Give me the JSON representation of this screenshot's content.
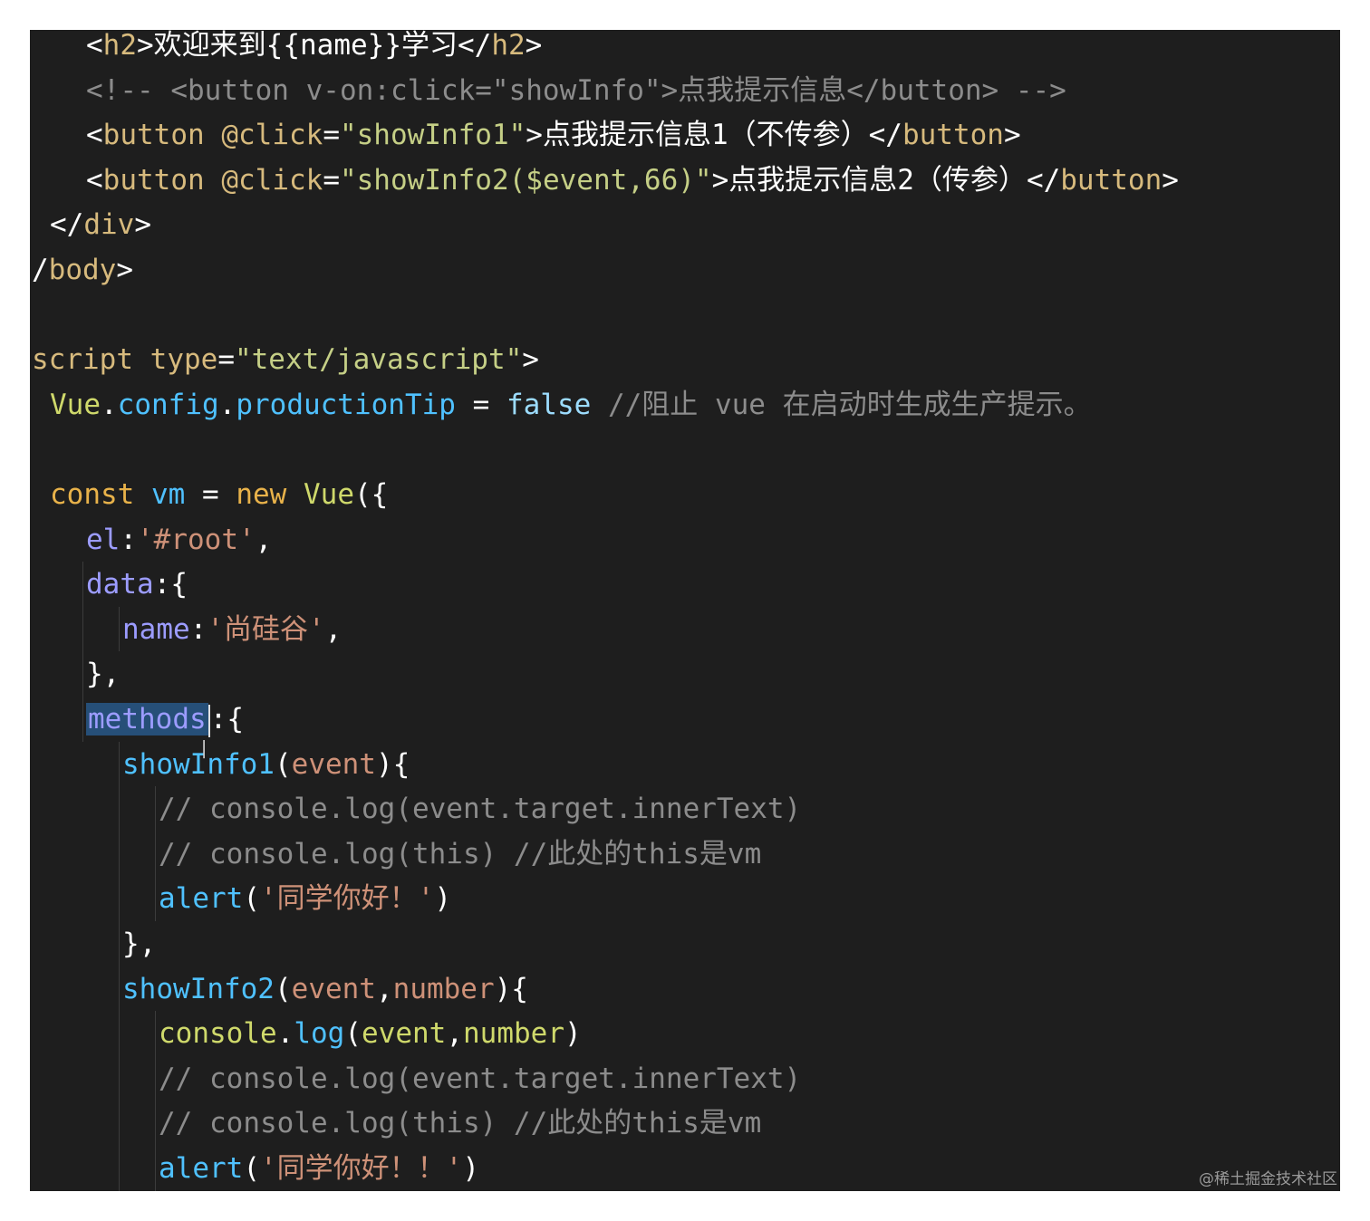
{
  "code": {
    "lines": [
      {
        "indent": 60,
        "tokens": [
          {
            "t": "<",
            "c": "t-txt"
          },
          {
            "t": "h2",
            "c": "t-tag"
          },
          {
            "t": ">",
            "c": "t-txt"
          },
          {
            "t": "欢迎来到{{name}}学习",
            "c": "t-txt"
          },
          {
            "t": "</",
            "c": "t-txt"
          },
          {
            "t": "h2",
            "c": "t-tag"
          },
          {
            "t": ">",
            "c": "t-txt"
          }
        ]
      },
      {
        "indent": 60,
        "tokens": [
          {
            "t": "<!-- <button v-on:click=\"showInfo\">点我提示信息</button> -->",
            "c": "t-cmt"
          }
        ]
      },
      {
        "indent": 60,
        "tokens": [
          {
            "t": "<",
            "c": "t-txt"
          },
          {
            "t": "button",
            "c": "t-tag"
          },
          {
            "t": " ",
            "c": "t-txt"
          },
          {
            "t": "@click",
            "c": "t-attr"
          },
          {
            "t": "=",
            "c": "t-txt"
          },
          {
            "t": "\"showInfo1\"",
            "c": "t-str2"
          },
          {
            "t": ">",
            "c": "t-txt"
          },
          {
            "t": "点我提示信息1（不传参）",
            "c": "t-txt"
          },
          {
            "t": "</",
            "c": "t-txt"
          },
          {
            "t": "button",
            "c": "t-tag"
          },
          {
            "t": ">",
            "c": "t-txt"
          }
        ]
      },
      {
        "indent": 60,
        "tokens": [
          {
            "t": "<",
            "c": "t-txt"
          },
          {
            "t": "button",
            "c": "t-tag"
          },
          {
            "t": " ",
            "c": "t-txt"
          },
          {
            "t": "@click",
            "c": "t-attr"
          },
          {
            "t": "=",
            "c": "t-txt"
          },
          {
            "t": "\"showInfo2($event,66)\"",
            "c": "t-str2"
          },
          {
            "t": ">",
            "c": "t-txt"
          },
          {
            "t": "点我提示信息2（传参）",
            "c": "t-txt"
          },
          {
            "t": "</",
            "c": "t-txt"
          },
          {
            "t": "button",
            "c": "t-tag"
          },
          {
            "t": ">",
            "c": "t-txt"
          }
        ]
      },
      {
        "indent": 20,
        "tokens": [
          {
            "t": "</",
            "c": "t-txt"
          },
          {
            "t": "div",
            "c": "t-tag"
          },
          {
            "t": ">",
            "c": "t-txt"
          }
        ]
      },
      {
        "indent": 0,
        "tokens": [
          {
            "t": "/",
            "c": "t-txt"
          },
          {
            "t": "body",
            "c": "t-tag"
          },
          {
            "t": ">",
            "c": "t-txt"
          }
        ]
      },
      {
        "indent": 0,
        "tokens": []
      },
      {
        "indent": 0,
        "tokens": [
          {
            "t": "script",
            "c": "t-tag"
          },
          {
            "t": " ",
            "c": "t-txt"
          },
          {
            "t": "type",
            "c": "t-attr"
          },
          {
            "t": "=",
            "c": "t-txt"
          },
          {
            "t": "\"text/javascript\"",
            "c": "t-str2"
          },
          {
            "t": ">",
            "c": "t-txt"
          }
        ]
      },
      {
        "indent": 20,
        "tokens": [
          {
            "t": "Vue",
            "c": "t-obj"
          },
          {
            "t": ".",
            "c": "t-txt"
          },
          {
            "t": "config",
            "c": "t-fn"
          },
          {
            "t": ".",
            "c": "t-txt"
          },
          {
            "t": "productionTip",
            "c": "t-fn"
          },
          {
            "t": " = ",
            "c": "t-txt"
          },
          {
            "t": "false",
            "c": "t-bool"
          },
          {
            "t": " //阻止 vue 在启动时生成生产提示。",
            "c": "t-cmt"
          }
        ]
      },
      {
        "indent": 0,
        "tokens": []
      },
      {
        "indent": 20,
        "tokens": [
          {
            "t": "const",
            "c": "t-kw"
          },
          {
            "t": " ",
            "c": "t-txt"
          },
          {
            "t": "vm",
            "c": "t-fn"
          },
          {
            "t": " = ",
            "c": "t-txt"
          },
          {
            "t": "new",
            "c": "t-kw"
          },
          {
            "t": " ",
            "c": "t-txt"
          },
          {
            "t": "Vue",
            "c": "t-obj"
          },
          {
            "t": "({",
            "c": "t-txt"
          }
        ]
      },
      {
        "indent": 60,
        "tokens": [
          {
            "t": "el",
            "c": "t-meth"
          },
          {
            "t": ":",
            "c": "t-txt"
          },
          {
            "t": "'#root'",
            "c": "t-str"
          },
          {
            "t": ",",
            "c": "t-txt"
          }
        ]
      },
      {
        "indent": 60,
        "tokens": [
          {
            "t": "data",
            "c": "t-meth"
          },
          {
            "t": ":{",
            "c": "t-txt"
          }
        ]
      },
      {
        "indent": 100,
        "tokens": [
          {
            "t": "name",
            "c": "t-meth"
          },
          {
            "t": ":",
            "c": "t-txt"
          },
          {
            "t": "'尚硅谷'",
            "c": "t-str"
          },
          {
            "t": ",",
            "c": "t-txt"
          }
        ]
      },
      {
        "indent": 60,
        "tokens": [
          {
            "t": "},",
            "c": "t-txt"
          }
        ]
      },
      {
        "indent": 60,
        "tokens": [
          {
            "t": "methods",
            "c": "t-meth",
            "sel": true
          },
          {
            "t": "CARET",
            "c": "caret"
          },
          {
            "t": ":{",
            "c": "t-txt"
          }
        ]
      },
      {
        "indent": 100,
        "tokens": [
          {
            "t": "showInfo1",
            "c": "t-fn"
          },
          {
            "t": "(",
            "c": "t-txt"
          },
          {
            "t": "event",
            "c": "t-str"
          },
          {
            "t": "){",
            "c": "t-txt"
          }
        ]
      },
      {
        "indent": 140,
        "tokens": [
          {
            "t": "// console.log(event.target.innerText)",
            "c": "t-cmt"
          }
        ]
      },
      {
        "indent": 140,
        "tokens": [
          {
            "t": "// console.log(this) //此处的this是vm",
            "c": "t-cmt"
          }
        ]
      },
      {
        "indent": 140,
        "tokens": [
          {
            "t": "alert",
            "c": "t-fn"
          },
          {
            "t": "(",
            "c": "t-txt"
          },
          {
            "t": "'同学你好！'",
            "c": "t-str"
          },
          {
            "t": ")",
            "c": "t-txt"
          }
        ]
      },
      {
        "indent": 100,
        "tokens": [
          {
            "t": "},",
            "c": "t-txt"
          }
        ]
      },
      {
        "indent": 100,
        "tokens": [
          {
            "t": "showInfo2",
            "c": "t-fn"
          },
          {
            "t": "(",
            "c": "t-txt"
          },
          {
            "t": "event",
            "c": "t-str"
          },
          {
            "t": ",",
            "c": "t-txt"
          },
          {
            "t": "number",
            "c": "t-str"
          },
          {
            "t": "){",
            "c": "t-txt"
          }
        ]
      },
      {
        "indent": 140,
        "tokens": [
          {
            "t": "console",
            "c": "t-obj"
          },
          {
            "t": ".",
            "c": "t-txt"
          },
          {
            "t": "log",
            "c": "t-fn"
          },
          {
            "t": "(",
            "c": "t-txt"
          },
          {
            "t": "event",
            "c": "t-obj"
          },
          {
            "t": ",",
            "c": "t-txt"
          },
          {
            "t": "number",
            "c": "t-obj"
          },
          {
            "t": ")",
            "c": "t-txt"
          }
        ]
      },
      {
        "indent": 140,
        "tokens": [
          {
            "t": "// console.log(event.target.innerText)",
            "c": "t-cmt"
          }
        ]
      },
      {
        "indent": 140,
        "tokens": [
          {
            "t": "// console.log(this) //此处的this是vm",
            "c": "t-cmt"
          }
        ]
      },
      {
        "indent": 140,
        "tokens": [
          {
            "t": "alert",
            "c": "t-fn"
          },
          {
            "t": "(",
            "c": "t-txt"
          },
          {
            "t": "'同学你好！！'",
            "c": "t-str"
          },
          {
            "t": ")",
            "c": "t-txt"
          }
        ]
      }
    ]
  },
  "watermark": "@稀土掘金技术社区"
}
